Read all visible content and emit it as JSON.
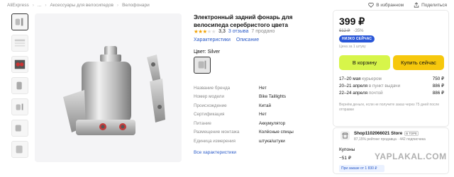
{
  "breadcrumb": [
    "AliExpress",
    "...",
    "Аксессуары для велосипедов",
    "Велофонари"
  ],
  "header": {
    "favorites": "В избранном",
    "share": "Поделиться"
  },
  "colors": {
    "accent": "#2b5bc8",
    "cart_btn": "#d7f54a",
    "buy_btn": "#f6c80d",
    "star": "#f0a000",
    "badge": "#2a57d8"
  },
  "product": {
    "title": "Электронный задний фонарь для велосипеда серебристого цвета",
    "rating": "3,3",
    "stars_filled": 3.3,
    "reviews": "3 отзыва",
    "sold": "7 продано",
    "tabs": [
      "Характеристики",
      "Описание"
    ],
    "color_label": "Цвет: Silver"
  },
  "specs": [
    {
      "k": "Название бренда",
      "v": "Нет"
    },
    {
      "k": "Номер модели",
      "v": "Bike Taillights"
    },
    {
      "k": "Происхождение",
      "v": "Китай"
    },
    {
      "k": "Сертификация",
      "v": "Нет"
    },
    {
      "k": "Питание",
      "v": "Аккумулятор"
    },
    {
      "k": "Размещение монтажа",
      "v": "Колёсные спицы"
    },
    {
      "k": "Единица измерения",
      "v": "штука/штуки"
    }
  ],
  "all_specs": "Все характеристики",
  "buy": {
    "price": "399 ₽",
    "old_price": "612 ₽",
    "discount": "-35%",
    "badge": "НИЗКО СЕЙЧАС",
    "unit_price": "Цена за 1 штуку",
    "cart": "В корзину",
    "buy_now": "Купить сейчас",
    "delivery": [
      {
        "date": "17–20 мая",
        "way": "курьером",
        "price": "750 ₽"
      },
      {
        "date": "20–21 апреля",
        "way": "в пункт выдачи",
        "price": "886 ₽"
      },
      {
        "date": "22–24 апреля",
        "way": "почтой",
        "price": "886 ₽"
      }
    ],
    "return_note": "Вернём деньги, если не получите заказ через 75 дней после отправки"
  },
  "shop": {
    "name": "Shop1102066021 Store",
    "tag": "В ТОРЕ",
    "stats": "87,15% рейтинг продавца · 442 подписчика",
    "coupons": "Купоны",
    "coupon_value": "−51 ₽",
    "coupon_note": "При заказе от 1 830 ₽"
  },
  "watermark": "YAPLAKAL.COM"
}
